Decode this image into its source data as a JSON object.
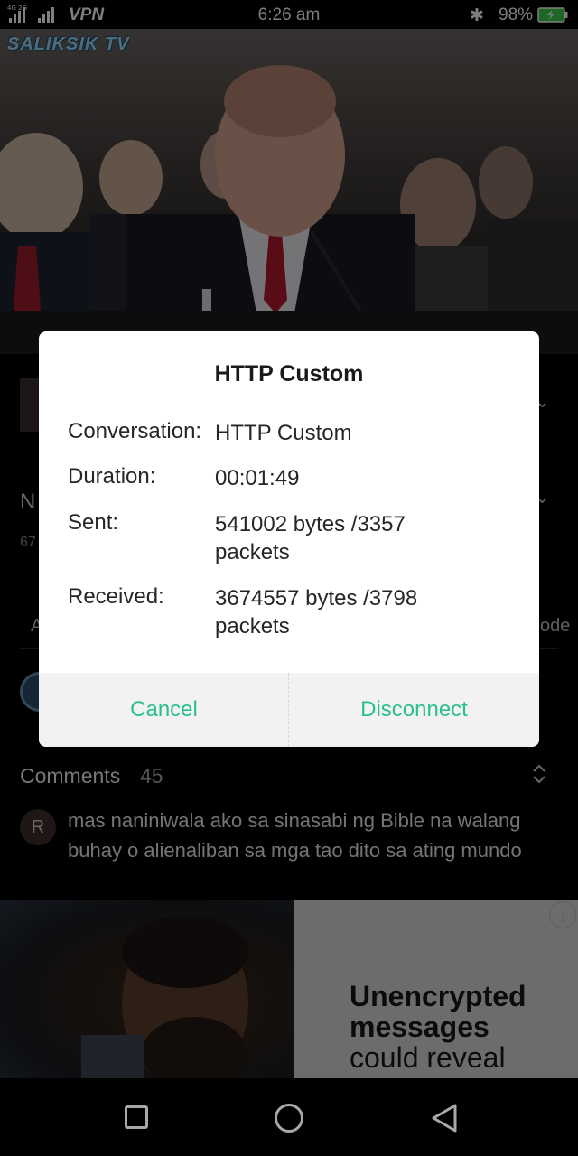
{
  "status_bar": {
    "network_label": "4G 2G",
    "vpn_label": "VPN",
    "time": "6:26 am",
    "bluetooth_icon": "bluetooth-icon",
    "battery_percent": "98%"
  },
  "video": {
    "channel_logo": "SALIKSIK TV"
  },
  "background_page": {
    "title_fragment": "N",
    "views_fragment": "67",
    "action_fragment": "A",
    "mode_fragment": "ode"
  },
  "comments": {
    "title": "Comments",
    "count": "45",
    "first_comment": {
      "avatar_letter": "R",
      "text": "mas naniniwala ako sa sinasabi ng Bible na walang buhay o alienaliban sa mga tao dito sa ating mundo"
    }
  },
  "ad": {
    "headline": "Unencrypted messages",
    "subtext": "could reveal",
    "info_icon": "info-icon"
  },
  "dialog": {
    "title": "HTTP Custom",
    "rows": [
      {
        "label": "Conversation:",
        "value": "HTTP Custom"
      },
      {
        "label": "Duration:",
        "value": "00:01:49"
      },
      {
        "label": "Sent:",
        "value": "541002 bytes /3357 packets"
      },
      {
        "label": "Received:",
        "value": "3674557 bytes /3798 packets"
      }
    ],
    "cancel_label": "Cancel",
    "disconnect_label": "Disconnect",
    "accent_color": "#2bbf8d"
  },
  "nav_bar": {
    "back_icon": "square-icon",
    "home_icon": "circle-icon",
    "recents_icon": "triangle-icon"
  }
}
